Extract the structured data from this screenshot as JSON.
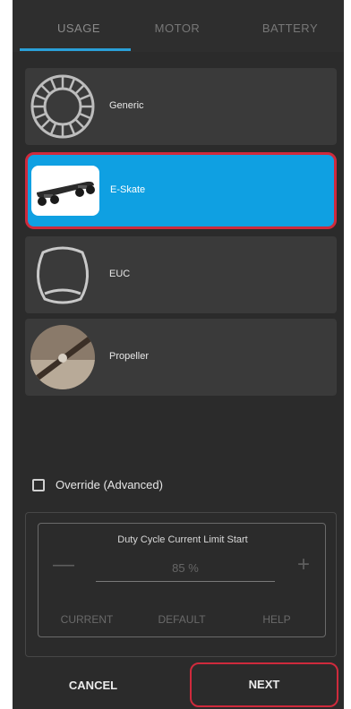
{
  "tabs": [
    {
      "label": "USAGE",
      "active": true
    },
    {
      "label": "MOTOR",
      "active": false
    },
    {
      "label": "BATTERY",
      "active": false
    }
  ],
  "usage_options": [
    {
      "label": "Generic",
      "icon": "generic-wheel-icon",
      "selected": false
    },
    {
      "label": "E-Skate",
      "icon": "eskate-board-image",
      "selected": true
    },
    {
      "label": "EUC",
      "icon": "euc-wheel-icon",
      "selected": false
    },
    {
      "label": "Propeller",
      "icon": "propeller-image",
      "selected": false
    }
  ],
  "override": {
    "label": "Override (Advanced)",
    "checked": false
  },
  "duty_cycle": {
    "title": "Duty Cycle Current Limit Start",
    "value": "85 %",
    "minus": "—",
    "plus": "+",
    "buttons": {
      "current": "CURRENT",
      "default": "DEFAULT",
      "help": "HELP"
    }
  },
  "footer": {
    "cancel": "CANCEL",
    "next": "NEXT"
  },
  "colors": {
    "accent": "#2aa0d8",
    "selected_card": "#0fa0e2",
    "highlight_border": "#cf2a3c",
    "background": "#2b2b2b"
  }
}
